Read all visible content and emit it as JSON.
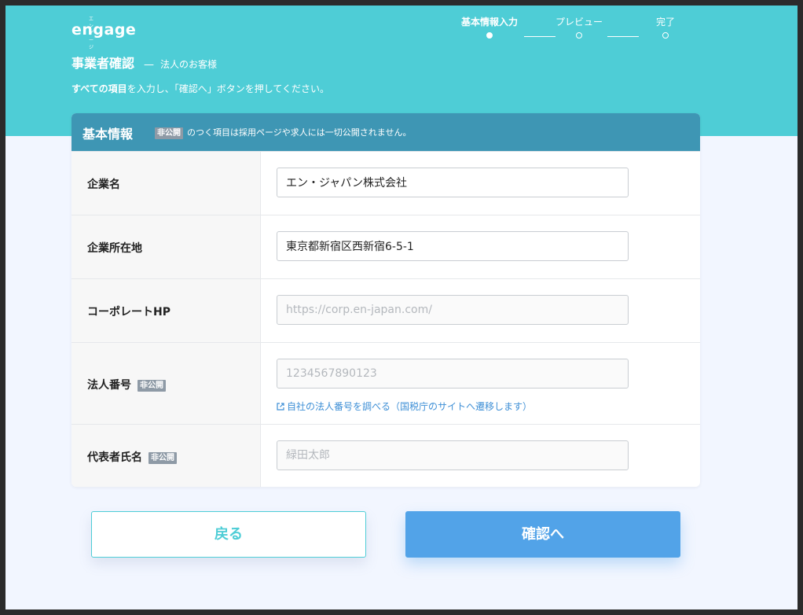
{
  "brand": {
    "logo_sub": "エンゲージ",
    "logo_main": "engage"
  },
  "steps": [
    {
      "label": "基本情報入力",
      "state": "current"
    },
    {
      "label": "プレビュー",
      "state": "todo"
    },
    {
      "label": "完了",
      "state": "todo"
    }
  ],
  "page": {
    "title": "事業者確認",
    "separator": "—",
    "subtitle": "法人のお客様",
    "instruction_bold": "すべての項目",
    "instruction_rest": "を入力し、「確認へ」ボタンを押してください。"
  },
  "card": {
    "title": "基本情報",
    "badge": "非公開",
    "note": "のつく項目は採用ページや求人には一切公開されません。"
  },
  "form": {
    "company_name": {
      "label": "企業名",
      "value": "エン・ジャパン株式会社",
      "placeholder": ""
    },
    "address": {
      "label": "企業所在地",
      "value": "東京都新宿区西新宿6-5-1",
      "placeholder": ""
    },
    "homepage": {
      "label": "コーポレートHP",
      "value": "",
      "placeholder": "https://corp.en-japan.com/"
    },
    "corporate_number": {
      "label": "法人番号",
      "badge": "非公開",
      "value": "",
      "placeholder": "1234567890123",
      "link": "自社の法人番号を調べる（国税庁のサイトへ遷移します）"
    },
    "representative": {
      "label": "代表者氏名",
      "badge": "非公開",
      "value": "",
      "placeholder": "緑田太郎"
    }
  },
  "buttons": {
    "back": "戻る",
    "confirm": "確認へ"
  },
  "colors": {
    "primary": "#4ecdd6",
    "card_header": "#3e96b4",
    "confirm": "#52a3e8",
    "badge": "#8e9aa6"
  },
  "icons": {
    "external_link": "external-link-icon"
  }
}
